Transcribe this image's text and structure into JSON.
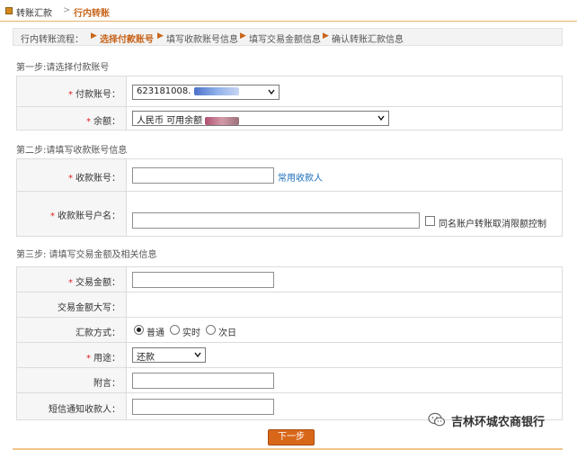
{
  "breadcrumb": {
    "parent": "转账汇款",
    "separator": ">",
    "current": "行内转账"
  },
  "flow": {
    "label": "行内转账流程：",
    "steps": [
      "选择付款账号",
      "填写收款账号信息",
      "填写交易金额信息",
      "确认转账汇款信息"
    ],
    "active_index": 0
  },
  "sections": {
    "step1_title": "第一步:请选择付款账号",
    "step2_title": "第二步:请填写收款账号信息",
    "step3_title": "第三步: 请填写交易金额及相关信息"
  },
  "step1": {
    "account_label": "付款账号：",
    "account_value": "623181008.",
    "balance_label": "余额：",
    "balance_value": "人民币 可用余额"
  },
  "step2": {
    "payee_account_label": "收款账号：",
    "payee_account_value": "",
    "common_payee_link": "常用收款人",
    "payee_name_label": "收款账号户名：",
    "payee_name_value": "",
    "same_name_checkbox_label": "同名账户转账取消限额控制",
    "same_name_checked": false
  },
  "step3": {
    "amount_label": "交易金额：",
    "amount_value": "",
    "amount_upper_label": "交易金额大写：",
    "remit_mode_label": "汇款方式：",
    "remit_options": [
      "普通",
      "实时",
      "次日"
    ],
    "remit_selected_index": 0,
    "purpose_label": "用途：",
    "purpose_value": "还款",
    "note_label": "附言：",
    "note_value": "",
    "sms_label": "短信通知收款人：",
    "sms_value": ""
  },
  "required_mark": "*",
  "next_button": "下一步",
  "watermark": "吉林环城农商银行",
  "colors": {
    "accent": "#c8651b",
    "button": "#d9671a",
    "link": "#1c6fb9",
    "required": "#e02020",
    "label_bg": "#f6f6f6"
  },
  "icons": {
    "topbar": "square-bullet-icon",
    "flow_arrow": "triangle-right-icon",
    "dropdown": "chevron-down-icon",
    "watermark": "wechat-icon"
  }
}
